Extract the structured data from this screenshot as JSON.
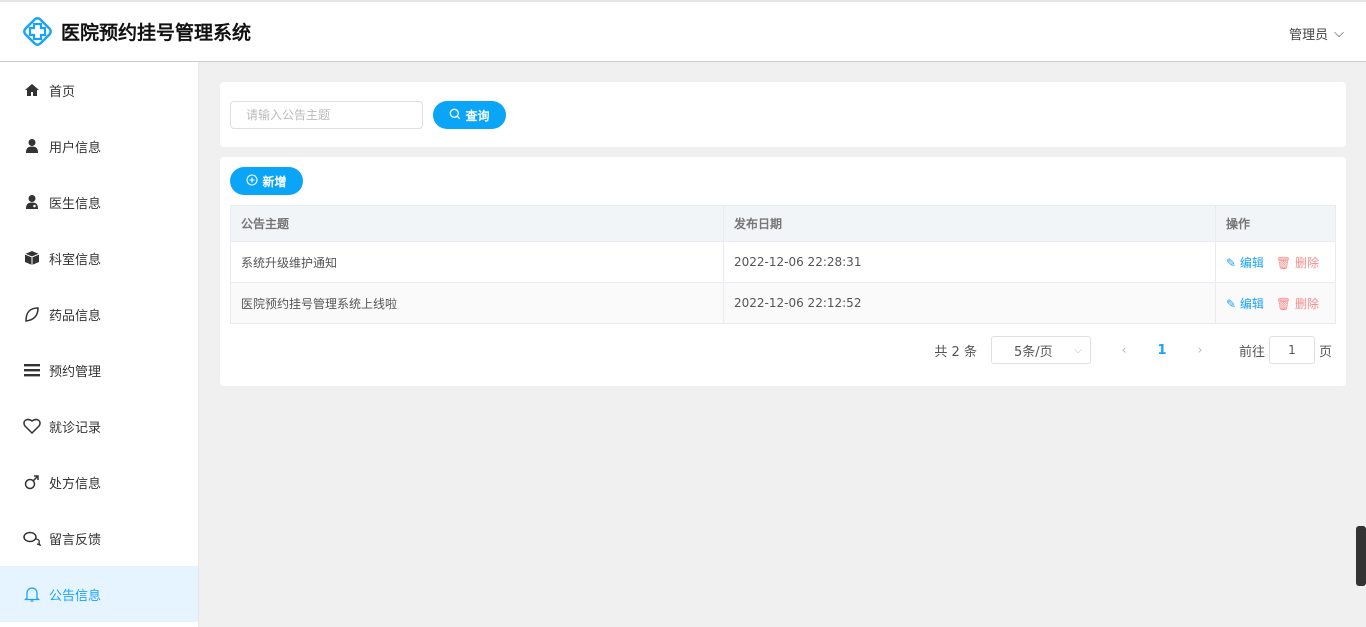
{
  "header": {
    "title": "医院预约挂号管理系统",
    "user": "管理员"
  },
  "sidebar": {
    "items": [
      {
        "label": "首页",
        "icon": "home-icon"
      },
      {
        "label": "用户信息",
        "icon": "user-icon"
      },
      {
        "label": "医生信息",
        "icon": "doctor-icon"
      },
      {
        "label": "科室信息",
        "icon": "cube-icon"
      },
      {
        "label": "药品信息",
        "icon": "leaf-icon"
      },
      {
        "label": "预约管理",
        "icon": "list-icon"
      },
      {
        "label": "就诊记录",
        "icon": "heart-icon"
      },
      {
        "label": "处方信息",
        "icon": "male-icon"
      },
      {
        "label": "留言反馈",
        "icon": "comments-icon"
      },
      {
        "label": "公告信息",
        "icon": "bell-icon"
      }
    ],
    "active": 9
  },
  "search": {
    "placeholder": "请输入公告主题",
    "button": "查询"
  },
  "toolbar": {
    "add": "新增"
  },
  "table": {
    "headers": [
      "公告主题",
      "发布日期",
      "操作"
    ],
    "rows": [
      {
        "title": "系统升级维护通知",
        "date": "2022-12-06 22:28:31"
      },
      {
        "title": "医院预约挂号管理系统上线啦",
        "date": "2022-12-06 22:12:52"
      }
    ],
    "edit": "编辑",
    "delete": "删除"
  },
  "pagination": {
    "total": "共 2 条",
    "page_size": "5条/页",
    "current": "1",
    "goto": "前往",
    "goto_value": "1",
    "page_suffix": "页"
  },
  "colors": {
    "accent": "#0ba5f7",
    "danger": "#f78b8b"
  }
}
